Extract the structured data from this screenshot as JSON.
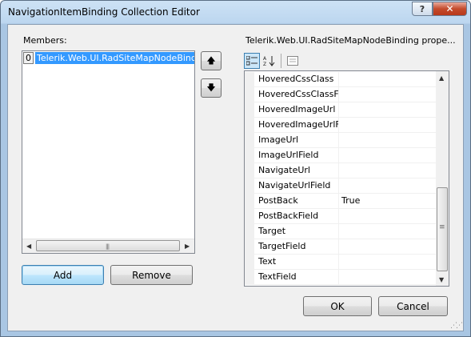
{
  "window": {
    "title": "NavigationItemBinding Collection Editor",
    "help_glyph": "?",
    "close_glyph": "✕"
  },
  "members": {
    "label": "Members:",
    "items": [
      {
        "index": "0",
        "text": "Telerik.Web.UI.RadSiteMapNodeBinding"
      }
    ],
    "move_up_glyph": "🡅",
    "move_down_glyph": "🡇"
  },
  "buttons": {
    "add": "Add",
    "remove": "Remove",
    "ok": "OK",
    "cancel": "Cancel"
  },
  "properties": {
    "label": "Telerik.Web.UI.RadSiteMapNodeBinding prope...",
    "toolbar": {
      "categorized_icon": "categorized-icon",
      "alphabetical_icon": "alphabetical-sort-icon",
      "property_pages_icon": "property-pages-icon"
    },
    "rows": [
      {
        "name": "HoveredCssClass",
        "value": ""
      },
      {
        "name": "HoveredCssClassField",
        "value": ""
      },
      {
        "name": "HoveredImageUrl",
        "value": ""
      },
      {
        "name": "HoveredImageUrlField",
        "value": ""
      },
      {
        "name": "ImageUrl",
        "value": ""
      },
      {
        "name": "ImageUrlField",
        "value": ""
      },
      {
        "name": "NavigateUrl",
        "value": ""
      },
      {
        "name": "NavigateUrlField",
        "value": ""
      },
      {
        "name": "PostBack",
        "value": "True"
      },
      {
        "name": "PostBackField",
        "value": ""
      },
      {
        "name": "Target",
        "value": ""
      },
      {
        "name": "TargetField",
        "value": ""
      },
      {
        "name": "Text",
        "value": ""
      },
      {
        "name": "TextField",
        "value": ""
      }
    ]
  },
  "colors": {
    "selection": "#3399ff",
    "client_bg": "#f0f0f0",
    "frame": "#a9c6e3"
  }
}
